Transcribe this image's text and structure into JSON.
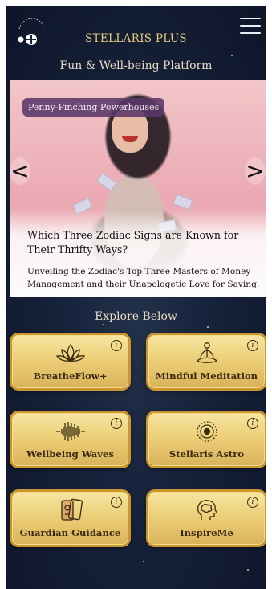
{
  "header": {
    "app_title": "STELLARIS PLUS",
    "subtitle": "Fun & Well-being Platform"
  },
  "carousel": {
    "tag": "Penny-Pinching Powerhouses",
    "headline": "Which Three Zodiac Signs are Known for Their Thrifty Ways?",
    "description": "Unveiling the Zodiac's Top Three Masters of Money Management and their Unapologetic Love for Saving.",
    "prev_label": "<",
    "next_label": ">"
  },
  "explore": {
    "title": "Explore Below",
    "info_glyph": "i",
    "tiles": [
      {
        "label": "BreatheFlow+",
        "icon": "lotus-icon"
      },
      {
        "label": "Mindful Meditation",
        "icon": "meditating-person-icon"
      },
      {
        "label": "Wellbeing Waves",
        "icon": "sound-wave-icon"
      },
      {
        "label": "Stellaris Astro",
        "icon": "zodiac-wheel-icon"
      },
      {
        "label": "Guardian Guidance",
        "icon": "tarot-cards-icon"
      },
      {
        "label": "InspireMe",
        "icon": "head-brain-icon"
      }
    ]
  },
  "colors": {
    "background": "#16213a",
    "gold_text": "#e8cc7a",
    "tile_gold": "#eccf78",
    "tile_border": "#c9962f",
    "tag_purple": "#5a3769"
  }
}
